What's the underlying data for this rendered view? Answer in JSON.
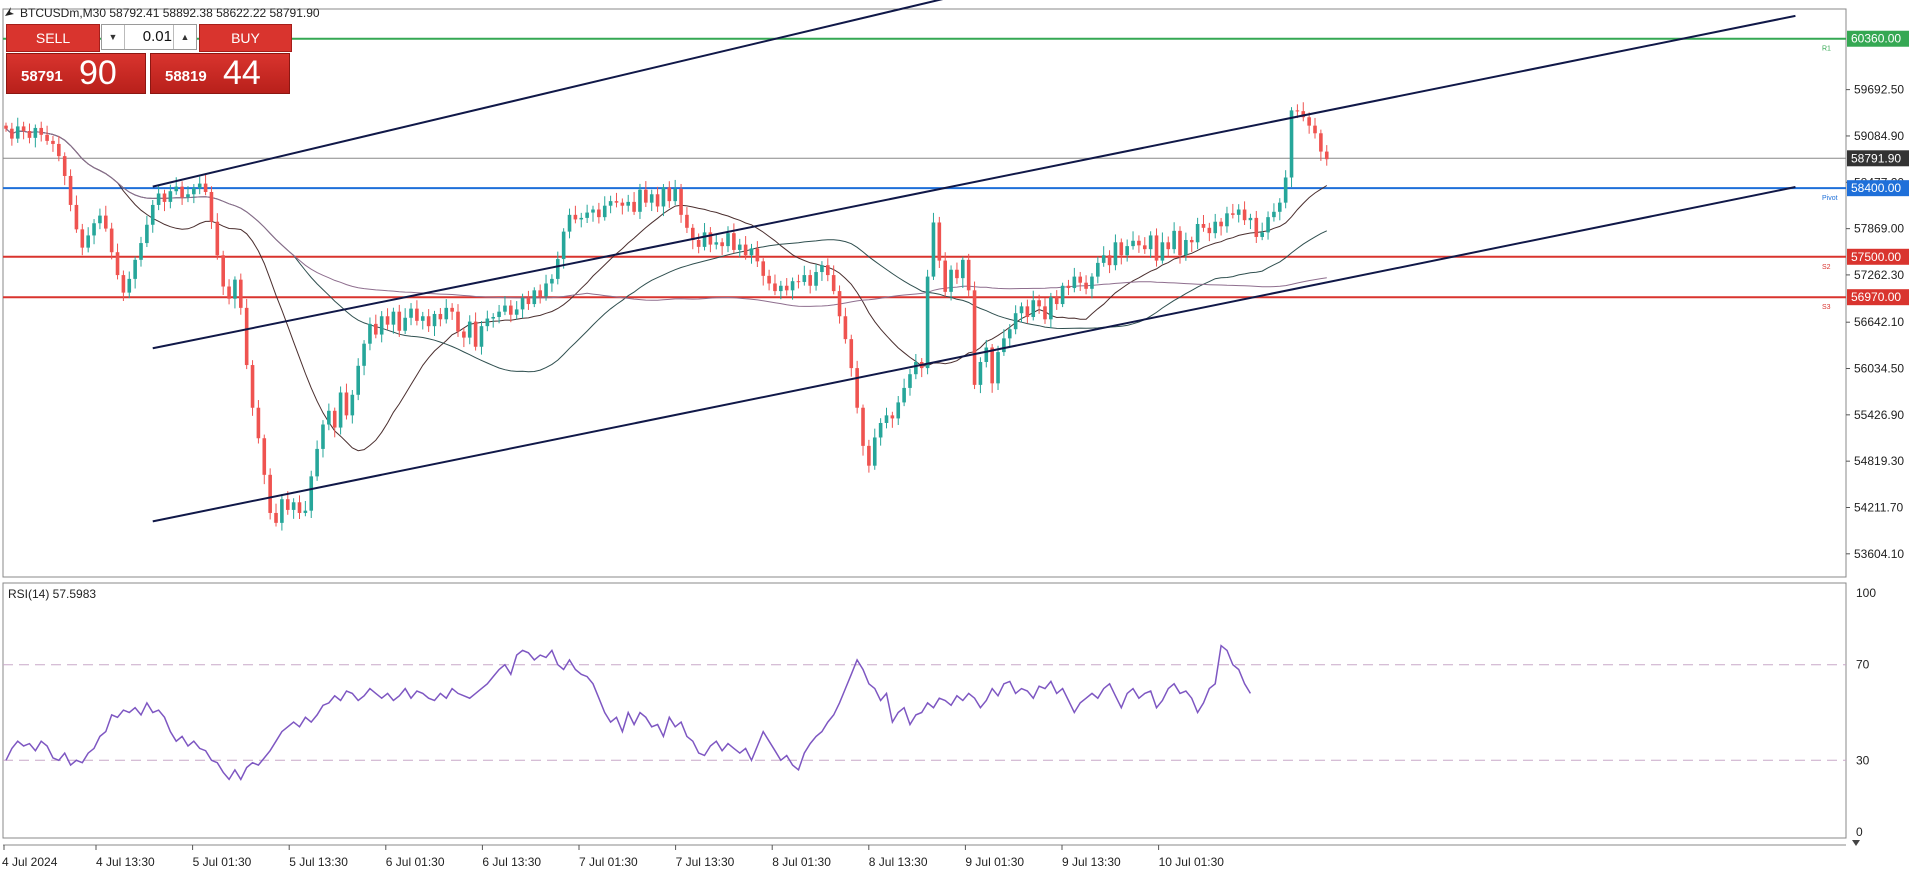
{
  "header": {
    "title": "BTCUSDm,M30  58792.41 58892.38 58622.22 58791.90"
  },
  "trade_panel": {
    "sell_label": "SELL",
    "buy_label": "BUY",
    "lot": "0.01",
    "sell_small": "58791",
    "sell_big": "90",
    "buy_small": "58819",
    "buy_big": "44"
  },
  "colors": {
    "bull": "#26a69a",
    "bear": "#ef5350",
    "rsi": "#7e57c2",
    "pivot": "#1e6fd9",
    "support": "#d9342e",
    "r1": "#35a853"
  },
  "chart_data": {
    "type": "candlestick",
    "price_range": [
      53300,
      60750
    ],
    "y_ticks": [
      53604.1,
      54211.7,
      54819.3,
      55426.9,
      56034.5,
      56642.1,
      57262.3,
      57869.0,
      58477.2,
      59084.9,
      59692.5
    ],
    "x_labels": [
      "4 Jul 2024",
      "4 Jul 13:30",
      "5 Jul 01:30",
      "5 Jul 13:30",
      "6 Jul 01:30",
      "6 Jul 13:30",
      "7 Jul 01:30",
      "7 Jul 13:30",
      "8 Jul 01:30",
      "8 Jul 13:30",
      "9 Jul 01:30",
      "9 Jul 13:30",
      "10 Jul 01:30"
    ],
    "levels": [
      {
        "name": "R1",
        "value": 60360.0,
        "label": "60360.00",
        "color": "#35a853",
        "tag": "R1"
      },
      {
        "name": "current",
        "value": 58791.9,
        "label": "58791.90",
        "color": "#888888",
        "tag": ""
      },
      {
        "name": "Pivot",
        "value": 58400.0,
        "label": "58400.00",
        "color": "#1e6fd9",
        "tag": "Pivot"
      },
      {
        "name": "S2",
        "value": 57500.0,
        "label": "57500.00",
        "color": "#d9342e",
        "tag": "S2"
      },
      {
        "name": "S3",
        "value": 56970.0,
        "label": "56970.00",
        "color": "#d9342e",
        "tag": "S3"
      }
    ],
    "trendlines": [
      {
        "from": [
          25,
          58420
        ],
        "to": [
          153,
          60760
        ]
      },
      {
        "from": [
          25,
          56300
        ],
        "to": [
          189,
          58855
        ]
      },
      {
        "from": [
          25,
          54030
        ],
        "to": [
          189,
          56600
        ]
      }
    ],
    "closes": [
      59180,
      59050,
      59210,
      59150,
      59060,
      59190,
      59100,
      59020,
      58980,
      58820,
      58560,
      58180,
      57860,
      57620,
      57780,
      57940,
      58040,
      57870,
      57560,
      57260,
      57030,
      57210,
      57460,
      57680,
      57920,
      58180,
      58330,
      58220,
      58360,
      58420,
      58280,
      58320,
      58400,
      58460,
      58350,
      57960,
      57520,
      57110,
      56950,
      57200,
      56830,
      56080,
      55520,
      55120,
      54640,
      54140,
      54010,
      54320,
      54180,
      54280,
      54140,
      54170,
      54620,
      54980,
      55300,
      55480,
      55260,
      55720,
      55420,
      55690,
      56070,
      56360,
      56620,
      56480,
      56720,
      56610,
      56780,
      56530,
      56700,
      56820,
      56660,
      56720,
      56590,
      56750,
      56680,
      56830,
      56780,
      56520,
      56440,
      56650,
      56320,
      56590,
      56690,
      56710,
      56780,
      56860,
      56740,
      56810,
      56960,
      56880,
      57060,
      56980,
      57150,
      57210,
      57470,
      57830,
      58050,
      57990,
      58010,
      58080,
      58120,
      58020,
      58170,
      58230,
      58210,
      58170,
      58220,
      58090,
      58380,
      58210,
      58320,
      58160,
      58410,
      58230,
      58390,
      58050,
      57880,
      57720,
      57630,
      57820,
      57660,
      57690,
      57640,
      57810,
      57590,
      57660,
      57520,
      57610,
      57440,
      57250,
      57150,
      57050,
      57120,
      57060,
      57180,
      57170,
      57260,
      57120,
      57300,
      57390,
      57260,
      57050,
      56720,
      56420,
      56040,
      55520,
      55020,
      54760,
      55130,
      55320,
      55420,
      55380,
      55590,
      55780,
      55960,
      56120,
      56040,
      57240,
      57950,
      57450,
      57040,
      57330,
      57220,
      57460,
      57060,
      55820,
      56120,
      56310,
      55840,
      56250,
      56430,
      56550,
      56760,
      56850,
      56710,
      56930,
      56850,
      56680,
      56970,
      56880,
      57120,
      57090,
      57240,
      57160,
      57080,
      57240,
      57420,
      57520,
      57390,
      57690,
      57520,
      57640,
      57710,
      57650,
      57600,
      57780,
      57450,
      57690,
      57600,
      57840,
      57520,
      57720,
      57690,
      57930,
      57880,
      57810,
      57960,
      57900,
      58070,
      58050,
      58120,
      57980,
      58010,
      57760,
      57820,
      58020,
      58090,
      58210,
      58540,
      59420,
      59410,
      59330,
      59220,
      59120,
      58880,
      58780
    ],
    "indicator": {
      "name": "RSI(14)",
      "value": "57.5983",
      "title": "RSI(14) 57.5983",
      "ticks": [
        100,
        70,
        30,
        0
      ],
      "levels": [
        70,
        30
      ],
      "values": [
        30,
        35,
        38,
        36,
        37,
        34,
        38,
        36,
        31,
        30,
        33,
        28,
        30,
        29,
        33,
        35,
        40,
        42,
        49,
        48,
        51,
        50,
        52,
        49,
        54,
        50,
        51,
        48,
        42,
        38,
        40,
        36,
        38,
        35,
        34,
        30,
        29,
        25,
        22,
        26,
        22,
        27,
        29,
        28,
        31,
        34,
        38,
        42,
        44,
        46,
        44,
        48,
        46,
        49,
        53,
        54,
        57,
        55,
        59,
        58,
        55,
        57,
        60,
        58,
        56,
        58,
        55,
        57,
        60,
        56,
        59,
        58,
        56,
        55,
        58,
        56,
        60,
        58,
        57,
        56,
        58,
        60,
        62,
        65,
        68,
        70,
        66,
        74,
        76,
        75,
        72,
        74,
        73,
        76,
        70,
        68,
        72,
        68,
        66,
        65,
        62,
        56,
        50,
        46,
        48,
        42,
        50,
        45,
        50,
        48,
        44,
        45,
        40,
        48,
        44,
        46,
        40,
        38,
        33,
        32,
        36,
        38,
        34,
        37,
        35,
        33,
        35,
        30,
        36,
        42,
        38,
        34,
        30,
        32,
        28,
        26,
        33,
        37,
        40,
        42,
        46,
        49,
        54,
        60,
        66,
        72,
        68,
        62,
        60,
        55,
        58,
        46,
        50,
        52,
        45,
        49,
        50,
        54,
        52,
        56,
        55,
        53,
        57,
        55,
        58,
        56,
        52,
        55,
        60,
        57,
        62,
        63,
        58,
        60,
        59,
        56,
        61,
        60,
        63,
        58,
        60,
        55,
        50,
        54,
        56,
        58,
        56,
        60,
        62,
        57,
        52,
        58,
        60,
        56,
        58,
        59,
        52,
        55,
        60,
        62,
        58,
        59,
        56,
        50,
        54,
        60,
        62,
        78,
        76,
        70,
        68,
        62,
        58
      ],
      "series_color": "#7e57c2"
    }
  }
}
